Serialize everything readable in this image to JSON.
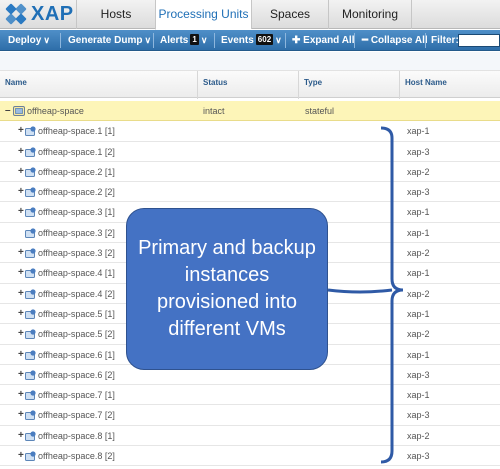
{
  "app": {
    "logo_text": "XAP"
  },
  "tabs": [
    {
      "label": "Hosts",
      "active": false
    },
    {
      "label": "Processing Units",
      "active": true
    },
    {
      "label": "Spaces",
      "active": false
    },
    {
      "label": "Monitoring",
      "active": false
    }
  ],
  "toolbar": {
    "deploy": "Deploy",
    "generate_dump": "Generate Dump",
    "alerts": "Alerts",
    "alerts_count": "1",
    "events": "Events",
    "events_count": "602",
    "expand_all": "Expand All",
    "collapse_all": "Collapse All",
    "filter": "Filter:"
  },
  "table": {
    "columns": [
      "Name",
      "Status",
      "Type",
      "Host Name"
    ],
    "root": {
      "name": "offheap-space",
      "status": "intact",
      "type": "stateful"
    },
    "rows": [
      {
        "name": "offheap-space.1 [1]",
        "host": "xap-1"
      },
      {
        "name": "offheap-space.1 [2]",
        "host": "xap-3"
      },
      {
        "name": "offheap-space.2 [1]",
        "host": "xap-2"
      },
      {
        "name": "offheap-space.2 [2]",
        "host": "xap-3"
      },
      {
        "name": "offheap-space.3 [1]",
        "host": "xap-1"
      },
      {
        "name": "offheap-space.3 [2]",
        "host": "xap-1"
      },
      {
        "name": "offheap-space.3 [2]",
        "host": "xap-2"
      },
      {
        "name": "offheap-space.4 [1]",
        "host": "xap-1"
      },
      {
        "name": "offheap-space.4 [2]",
        "host": "xap-2"
      },
      {
        "name": "offheap-space.5 [1]",
        "host": "xap-1"
      },
      {
        "name": "offheap-space.5 [2]",
        "host": "xap-2"
      },
      {
        "name": "offheap-space.6 [1]",
        "host": "xap-1"
      },
      {
        "name": "offheap-space.6 [2]",
        "host": "xap-3"
      },
      {
        "name": "offheap-space.7 [1]",
        "host": "xap-1"
      },
      {
        "name": "offheap-space.7 [2]",
        "host": "xap-3"
      },
      {
        "name": "offheap-space.8 [1]",
        "host": "xap-2"
      },
      {
        "name": "offheap-space.8 [2]",
        "host": "xap-3"
      }
    ]
  },
  "callout": {
    "text": "Primary and backup instances provisioned into different VMs"
  },
  "colors": {
    "accent": "#1f6fb6",
    "toolbar": "#3a7ab5",
    "selected_row": "#fdf5b8",
    "callout": "#4472c4"
  }
}
